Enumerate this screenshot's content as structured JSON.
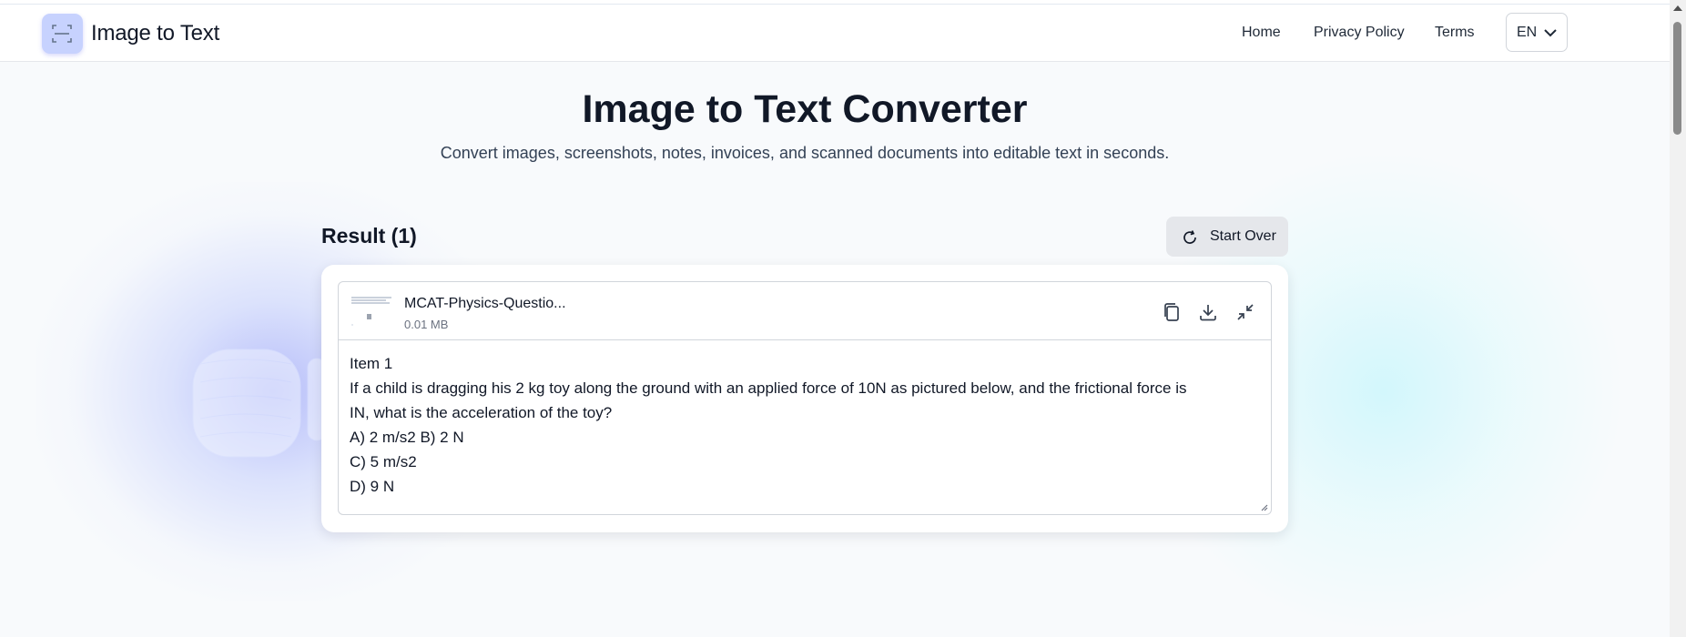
{
  "header": {
    "brand": "Image to Text",
    "nav": [
      {
        "label": "Home"
      },
      {
        "label": "Privacy Policy"
      },
      {
        "label": "Terms"
      }
    ],
    "language": "EN"
  },
  "hero": {
    "title": "Image to Text Converter",
    "subtitle": "Convert images, screenshots, notes, invoices, and scanned documents into editable text in seconds."
  },
  "result": {
    "heading": "Result (1)",
    "start_over_label": "Start Over",
    "file": {
      "name": "MCAT-Physics-Questio...",
      "size": "0.01 MB"
    },
    "text": "Item 1\nIf a child is dragging his 2 kg toy along the ground with an applied force of 10N as pictured below, and the frictional force is\nIN, what is the acceleration of the toy?\nA) 2 m/s2 B) 2 N\nC) 5 m/s2\nD) 9 N"
  },
  "icons": {
    "logo": "scan-icon",
    "language_toggle": "chevron-down-icon",
    "start_over": "refresh-icon",
    "copy": "copy-icon",
    "download": "download-icon",
    "collapse": "collapse-icon"
  },
  "colors": {
    "accent": "#818cf8",
    "logo_bg": "#c7d2fe",
    "button_bg": "#e5e7eb",
    "glow_cyan": "#a5f3fc"
  }
}
